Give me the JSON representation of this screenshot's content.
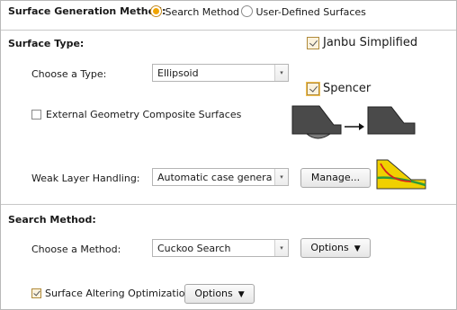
{
  "surface_generation": {
    "label": "Surface Generation Method:",
    "options": [
      "Search Method",
      "User-Defined Surfaces"
    ],
    "selected": "Search Method"
  },
  "surface_type": {
    "heading": "Surface Type:",
    "choose_label": "Choose a Type:",
    "type_value": "Ellipsoid",
    "janbu_label": "Janbu Simplified",
    "janbu_checked": true,
    "spencer_label": "Spencer",
    "spencer_checked": true,
    "external_geometry_label": "External Geometry Composite Surfaces",
    "external_geometry_checked": false,
    "weak_layer_label": "Weak Layer Handling:",
    "weak_layer_value": "Automatic case generatio",
    "manage_button": "Manage..."
  },
  "search_method": {
    "heading": "Search Method:",
    "choose_label": "Choose a Method:",
    "method_value": "Cuckoo Search",
    "options_button": "Options",
    "surface_altering_label": "Surface Altering Optimization",
    "surface_altering_checked": true,
    "options_button_2": "Options"
  },
  "icons": {
    "composite": "composite-surface-transform-icon",
    "weak_layer": "weak-layer-slope-icon",
    "dropdown": "dropdown-arrow-icon",
    "chevron": "chevron-down-icon"
  },
  "colors": {
    "radio_selected": "#f0a400",
    "checkbox_highlight": "#f2c050",
    "slope_dark": "#4a4a4a",
    "weak_layer_fill": "#f0d000",
    "weak_layer_green": "#2e9a3a",
    "weak_layer_red": "#d42020"
  }
}
